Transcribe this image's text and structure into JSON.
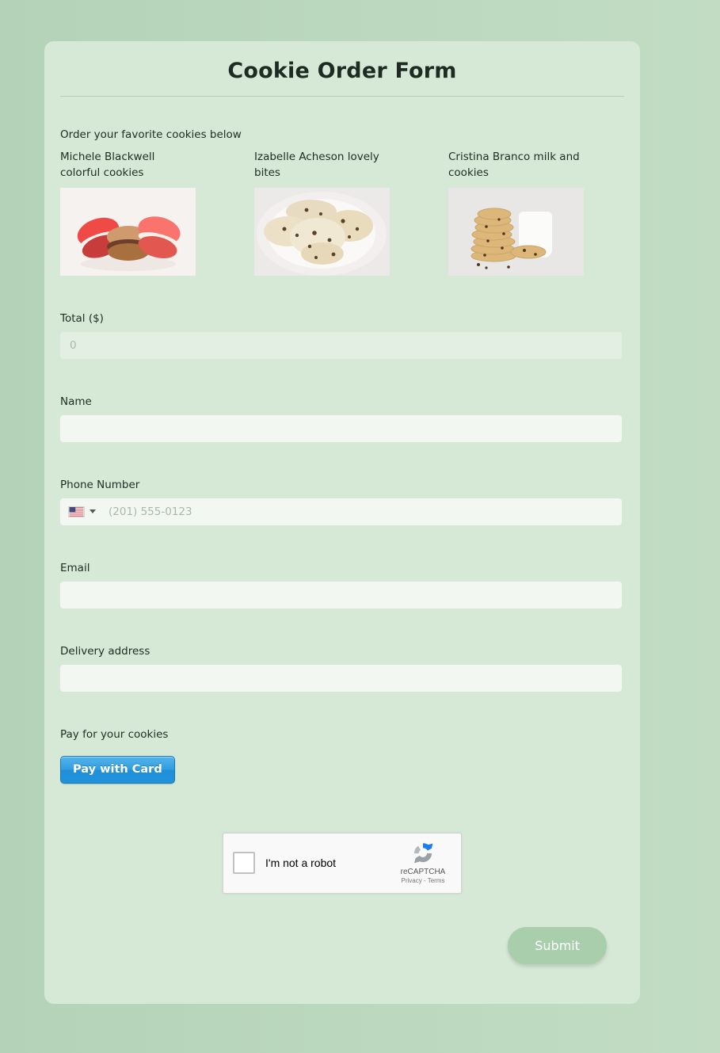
{
  "form": {
    "title": "Cookie Order Form",
    "products_label": "Order your favorite cookies below",
    "products": [
      {
        "name": "Michele Blackwell colorful cookies",
        "image": "red-macarons-photo"
      },
      {
        "name": "Izabelle Acheson lovely bites",
        "image": "chocolate-chip-cookies-plate-photo"
      },
      {
        "name": "Cristina Branco milk and cookies",
        "image": "cookie-stack-with-milk-photo"
      }
    ],
    "fields": {
      "total": {
        "label": "Total ($)",
        "value": "",
        "placeholder": "0",
        "disabled": true
      },
      "name": {
        "label": "Name",
        "value": "",
        "placeholder": ""
      },
      "phone": {
        "label": "Phone Number",
        "value": "",
        "placeholder": "(201) 555-0123",
        "country_flag": "us-flag-icon"
      },
      "email": {
        "label": "Email",
        "value": "",
        "placeholder": ""
      },
      "address": {
        "label": "Delivery address",
        "value": "",
        "placeholder": ""
      }
    },
    "payment": {
      "label": "Pay for your cookies",
      "button_label": "Pay with Card"
    },
    "captcha": {
      "checkbox_label": "I'm not a robot",
      "brand": "reCAPTCHA",
      "links": "Privacy - Terms"
    },
    "submit_label": "Submit"
  },
  "colors": {
    "page_background": "#bcd9bf",
    "card_background": "#d6e8d6",
    "input_background": "#f2f7f2",
    "input_disabled_background": "#e3efe3",
    "pay_button": "#2f9de0",
    "submit_button": "#a8ceac",
    "text": "#1f2d24"
  }
}
